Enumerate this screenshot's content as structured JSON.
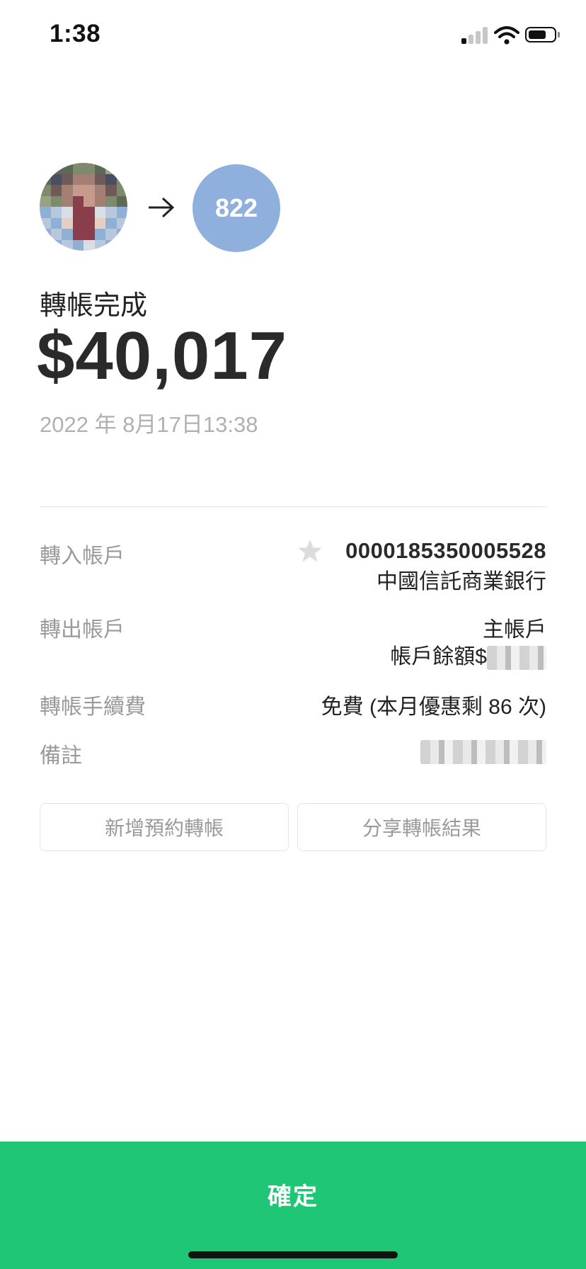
{
  "status_bar": {
    "time": "1:38"
  },
  "transfer": {
    "recipient_avatar_text": "822",
    "title": "轉帳完成",
    "amount": "$40,017",
    "datetime": "2022 年 8月17日13:38"
  },
  "details": {
    "to_account_label": "轉入帳戶",
    "to_account_number": "0000185350005528",
    "to_account_bank": "中國信託商業銀行",
    "from_account_label": "轉出帳戶",
    "from_account_name": "主帳戶",
    "from_balance_label": "帳戶餘額$",
    "fee_label": "轉帳手續費",
    "fee_value": "免費 (本月優惠剩 86 次)",
    "note_label": "備註"
  },
  "actions": {
    "schedule_transfer": "新增預約轉帳",
    "share_result": "分享轉帳結果",
    "confirm": "確定"
  },
  "colors": {
    "accent": "#1fc675",
    "recipient_avatar": "#8fb0dd"
  }
}
